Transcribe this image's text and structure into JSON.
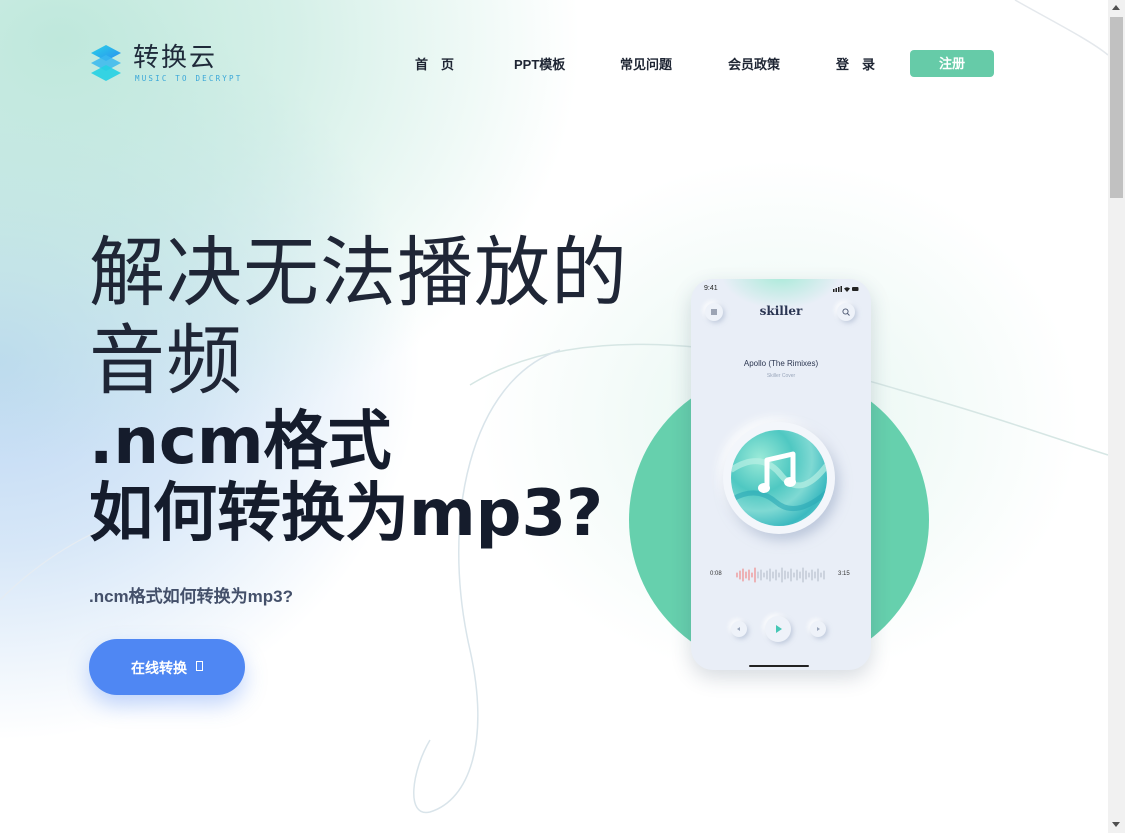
{
  "logo": {
    "title": "转换云",
    "subtitle": "MUSIC TO DECRYPT"
  },
  "nav": {
    "items": [
      "首　页",
      "PPT模板",
      "常见问题",
      "会员政策",
      "登　录"
    ],
    "register": "注册"
  },
  "hero": {
    "line1": "解决无法播放的",
    "line2": "音频",
    "line3": ".ncm格式",
    "line4": "如何转换为mp3?",
    "subtitle": ".ncm格式如何转换为mp3?",
    "cta": "在线转换"
  },
  "phone": {
    "time": "9:41",
    "brand": "skiller",
    "song": "Apollo (The Rimixes)",
    "artist": "Skiller Cover",
    "elapsed": "0:08",
    "total": "3:15",
    "icons": [
      "menu-icon",
      "search-icon",
      "music-note-icon",
      "previous-icon",
      "play-icon",
      "next-icon"
    ]
  },
  "colors": {
    "accent_green": "#66cba8",
    "cta_blue": "#4f87f3",
    "circle_green": "#66d0ad",
    "text_dark": "#1f2636"
  }
}
